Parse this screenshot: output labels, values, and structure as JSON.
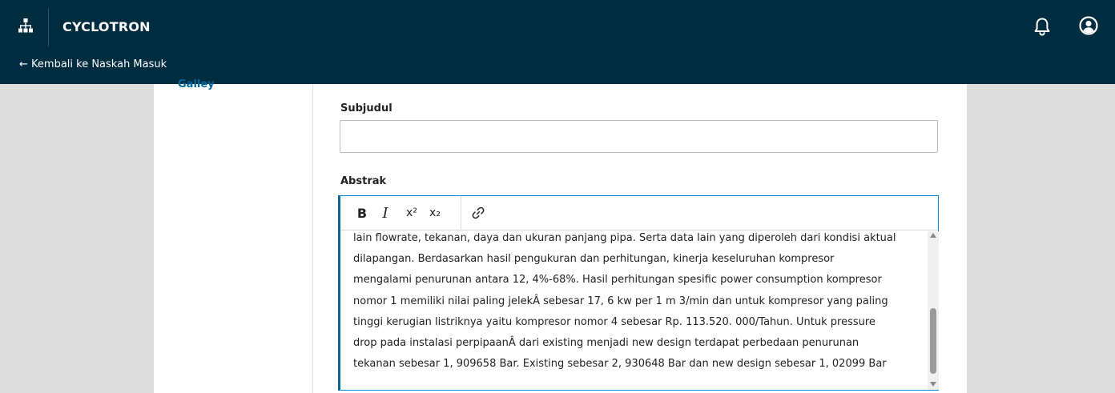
{
  "header": {
    "app_title": "CYCLOTRON",
    "back_link": "← Kembali ke Naskah Masuk",
    "icons": {
      "org": "sitemap-icon",
      "notifications": "bell-icon",
      "user": "user-circle-icon"
    },
    "colors": {
      "header_bg": "#002c40",
      "link": "#006798",
      "editor_border": "#008acb"
    }
  },
  "sidebar": {
    "items": [
      {
        "label": "Galley"
      }
    ]
  },
  "form": {
    "subtitle": {
      "label": "Subjudul",
      "value": ""
    },
    "abstract": {
      "label": "Abstrak",
      "toolbar": {
        "bold": "B",
        "italic": "I",
        "superscript": "x²",
        "subscript": "x₂",
        "link_icon": "link-icon"
      },
      "lines": [
        "lain flowrate, tekanan, daya dan ukuran panjang pipa. Serta data lain yang diperoleh dari kondisi aktual",
        "dilapangan. Berdasarkan hasil pengukuran dan perhitungan, kinerja keseluruhan kompresor",
        "mengalami penurunan antara 12, 4%-68%. Hasil perhitungan spesific power consumption kompresor",
        "nomor 1 memiliki nilai paling jelekÂ sebesar 17, 6 kw per 1 m 3/min dan untuk kompresor yang paling",
        "tinggi kerugian listriknya yaitu kompresor nomor 4 sebesar Rp. 113.520. 000/Tahun. Untuk pressure",
        "drop pada instalasi perpipaanÂ dari existing menjadi new design terdapat perbedaan penurunan",
        "tekanan sebesar 1, 909658 Bar. Existing sebesar 2, 930648 Bar dan new design sebesar 1, 02099 Bar"
      ]
    }
  }
}
